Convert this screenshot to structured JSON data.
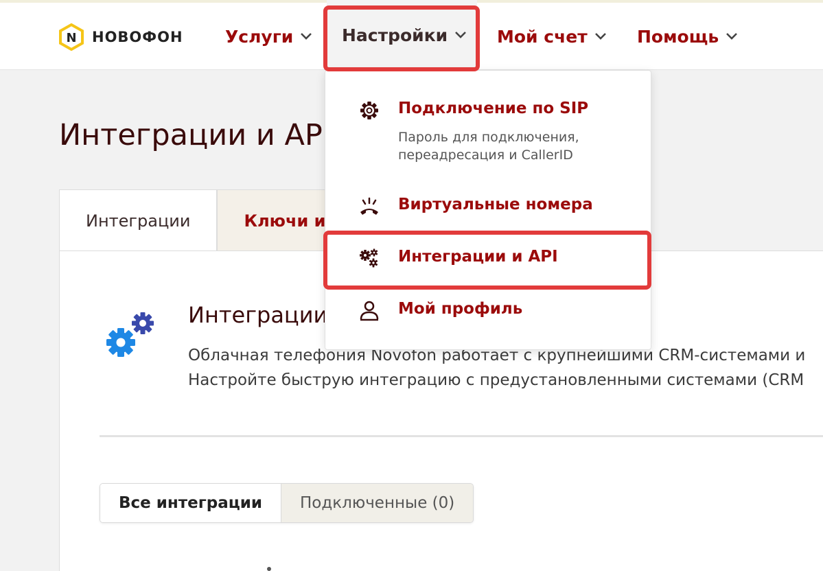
{
  "brand": {
    "name": "НОВОФОН",
    "logo_letter": "N",
    "accent": "#f5c518"
  },
  "nav": {
    "items": [
      {
        "label": "Услуги"
      },
      {
        "label": "Настройки"
      },
      {
        "label": "Мой счет"
      },
      {
        "label": "Помощь"
      }
    ]
  },
  "dropdown": {
    "items": [
      {
        "icon": "gear-icon",
        "label": "Подключение по SIP",
        "sub": "Пароль для подключения, переадресация и CallerID"
      },
      {
        "icon": "phone-ringing-icon",
        "label": "Виртуальные номера"
      },
      {
        "icon": "gears-icon",
        "label": "Интеграции и API"
      },
      {
        "icon": "user-icon",
        "label": "Мой профиль"
      }
    ]
  },
  "page": {
    "title": "Интеграции и API",
    "tabs": [
      {
        "label": "Интеграции"
      },
      {
        "label": "Ключи и API"
      }
    ],
    "section": {
      "title": "Интеграции",
      "desc_line1": "Облачная телефония Novofon работает с крупнейшими CRM-системами и",
      "desc_line2": "Настройте быструю интеграцию с предустановленными системами (CRM"
    },
    "filters": [
      {
        "label": "Все интеграции"
      },
      {
        "label": "Подключенные (0)"
      }
    ]
  },
  "colors": {
    "highlight": "#e23b3b",
    "link": "#9b0b0b",
    "gear_blue": "#1e88e5",
    "gear_indigo": "#3949ab"
  }
}
